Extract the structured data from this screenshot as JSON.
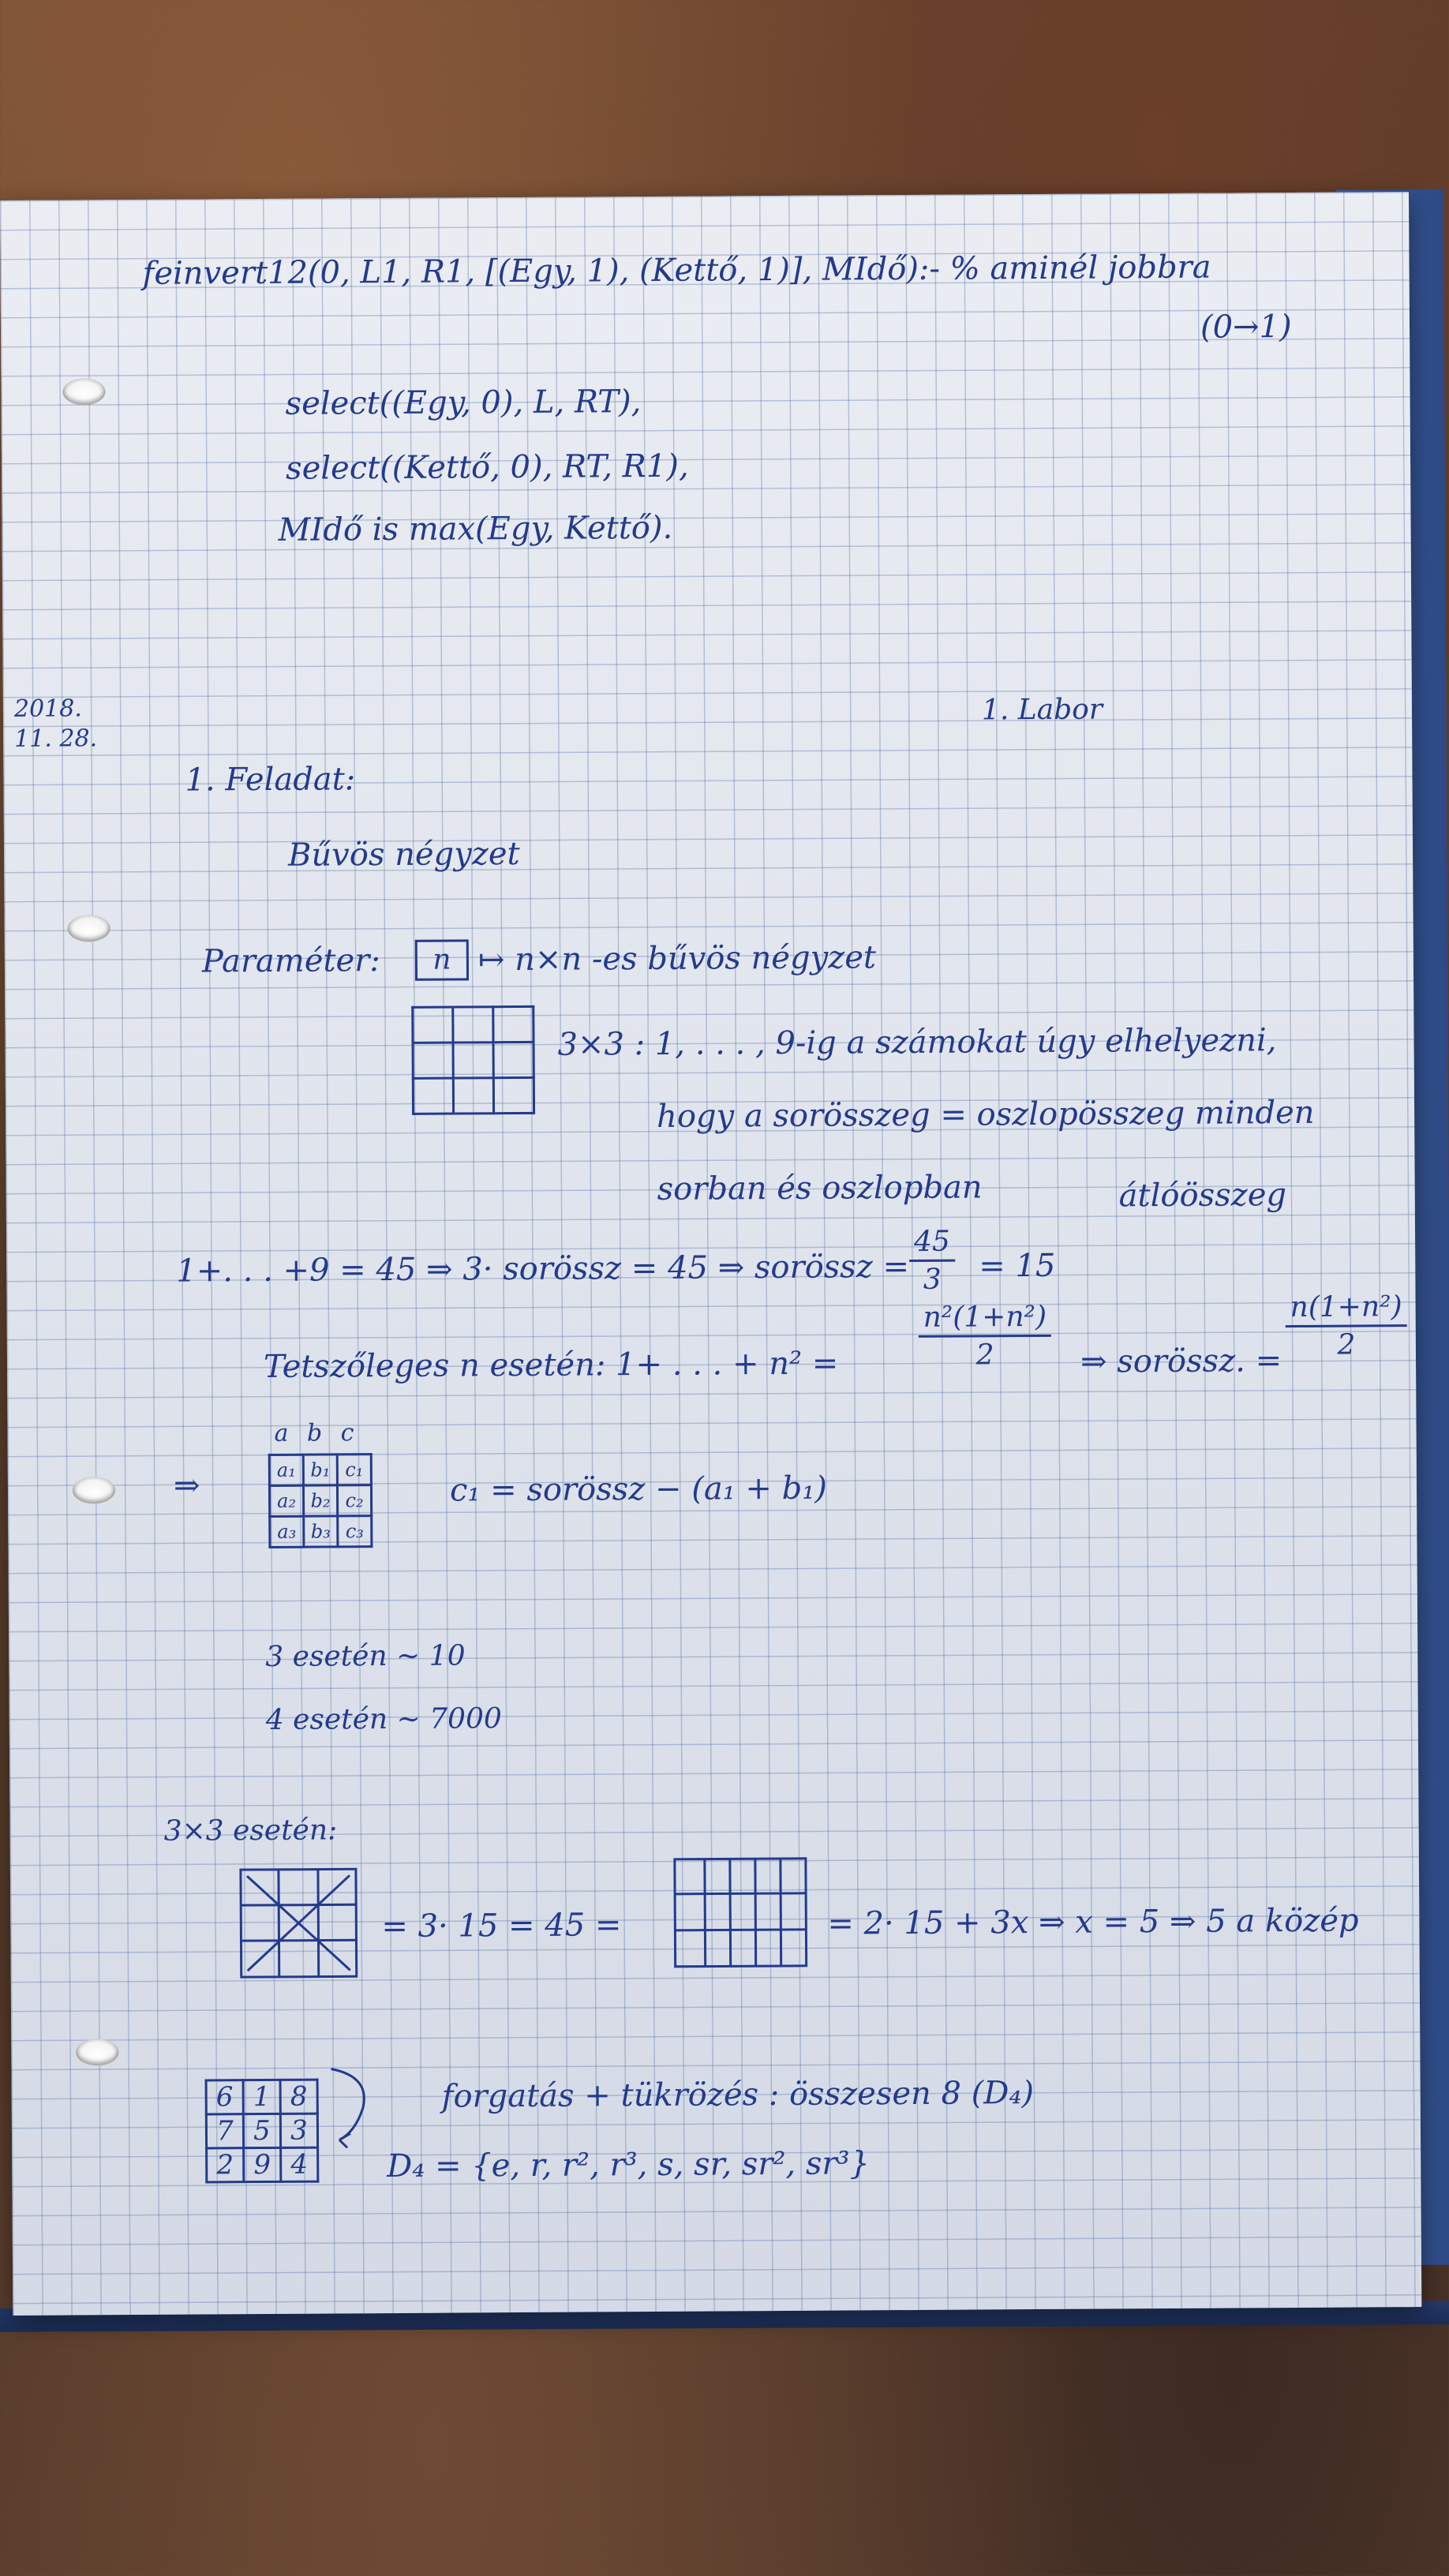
{
  "lines": {
    "l1": "feinvert12(0, L1, R1, [(Egy, 1), (Kettő, 1)], MIdő):- % aminél jobbra",
    "l1b": "(0→1)",
    "l2": "select((Egy, 0), L, RT),",
    "l3": "select((Kettő, 0), RT, R1),",
    "l4": "MIdő is max(Egy, Kettő).",
    "date1": "2018.",
    "date2": "11. 28.",
    "labor": "1. Labor",
    "feladat": "1. Feladat:",
    "buvos": "Bűvös négyzet",
    "param_label": "Paraméter:",
    "param_n": "n",
    "param_rest": "↦ n×n -es bűvös négyzet",
    "desc1": "3×3 : 1, . . . , 9-ig a számokat úgy elhelyezni,",
    "desc2": "hogy a sorösszeg = oszlopösszeg minden",
    "desc3": "sorban és oszlopban",
    "desc3b": "átlóösszeg",
    "sum_line_a": "1+. . . +9 = 45 ⇒ 3· sorössz = 45 ⇒ sorössz =",
    "sum_num": "45",
    "sum_den": "3",
    "sum_line_b": "= 15",
    "tetsz_a": "Tetszőleges n esetén:  1+ . . . + n² =",
    "tetsz_num": "n²(1+n²)",
    "tetsz_den": "2",
    "tetsz_b": "⇒ sorössz. =",
    "tetsz_num2": "n(1+n²)",
    "tetsz_den2": "2",
    "implies": "⇒",
    "abc_header": "a b c",
    "c1_formula": "c₁ = sorössz − (a₁ + b₁)",
    "case3": "3 esetén ∼ 10",
    "case4": "4 esetén ∼ 7000",
    "case3x3": "3×3 esetén:",
    "eq1": "= 3· 15 = 45 =",
    "eq2": "= 2· 15 + 3x ⇒ x = 5 ⇒  5 a közép",
    "forg": "forgatás + tükrözés : összesen 8 (D₄)",
    "d4": "D₄ = {e, r, r², r³, s, sr, sr², sr³}"
  },
  "abc_table": [
    [
      "a₁",
      "b₁",
      "c₁"
    ],
    [
      "a₂",
      "b₂",
      "c₂"
    ],
    [
      "a₃",
      "b₃",
      "c₃"
    ]
  ],
  "magic": [
    [
      "6",
      "1",
      "8"
    ],
    [
      "7",
      "5",
      "3"
    ],
    [
      "2",
      "9",
      "4"
    ]
  ]
}
